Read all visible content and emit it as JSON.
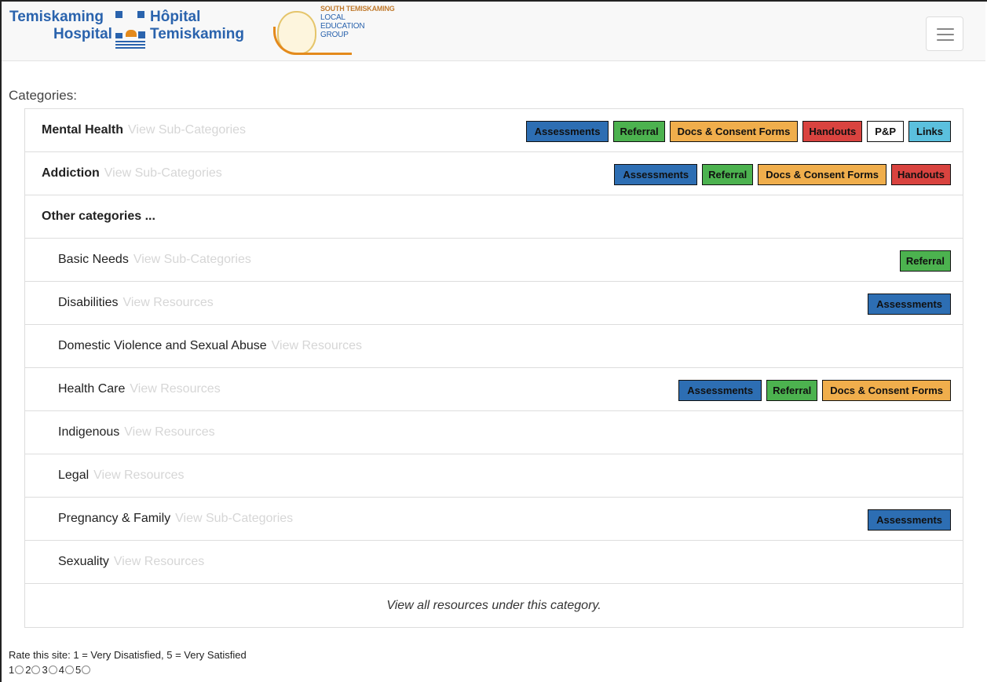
{
  "header": {
    "logo1": {
      "line1_left": "Temiskaming",
      "line1_right": "Hôpital",
      "line2_left": "Hospital",
      "line2_right": "Temiskaming"
    },
    "logo2": {
      "line1": "SOUTH TEMISKAMING",
      "line2": "LOCAL",
      "line3": "EDUCATION",
      "line4": "GROUP"
    },
    "menu_icon": "hamburger-icon"
  },
  "categories_label": "Categories:",
  "rows": [
    {
      "name": "Mental Health",
      "bold": true,
      "view": "View Sub-Categories",
      "badges": [
        "Assessments",
        "Referral",
        "Docs & Consent Forms",
        "Handouts",
        "P&P",
        "Links"
      ]
    },
    {
      "name": "Addiction",
      "bold": true,
      "view": "View Sub-Categories",
      "badges": [
        "Assessments",
        "Referral",
        "Docs & Consent Forms",
        "Handouts"
      ]
    },
    {
      "name": "Other categories ...",
      "bold": true,
      "view": "",
      "badges": []
    },
    {
      "name": "Basic Needs",
      "view": "View Sub-Categories",
      "badges": [
        "Referral"
      ]
    },
    {
      "name": "Disabilities",
      "view": "View Resources",
      "badges": [
        "Assessments"
      ]
    },
    {
      "name": "Domestic Violence and Sexual Abuse",
      "view": "View Resources",
      "badges": []
    },
    {
      "name": "Health Care",
      "view": "View Resources",
      "badges": [
        "Assessments",
        "Referral",
        "Docs & Consent Forms"
      ]
    },
    {
      "name": "Indigenous",
      "view": "View Resources",
      "badges": []
    },
    {
      "name": "Legal",
      "view": "View Resources",
      "badges": []
    },
    {
      "name": "Pregnancy & Family",
      "view": "View Sub-Categories",
      "badges": [
        "Assessments"
      ]
    },
    {
      "name": "Sexuality",
      "view": "View Resources",
      "badges": []
    }
  ],
  "view_all": "View all resources under this category.",
  "rating": {
    "prompt": "Rate this site: 1 = Very Disatisfied, 5 = Very Satisfied",
    "options": [
      "1",
      "2",
      "3",
      "4",
      "5"
    ]
  },
  "colors": {
    "Assessments": "#2d6eb3",
    "Referral": "#4cb24f",
    "Docs & Consent Forms": "#f0ae4c",
    "Handouts": "#d9433f",
    "P&P": "#ffffff",
    "Links": "#5bc0de"
  }
}
